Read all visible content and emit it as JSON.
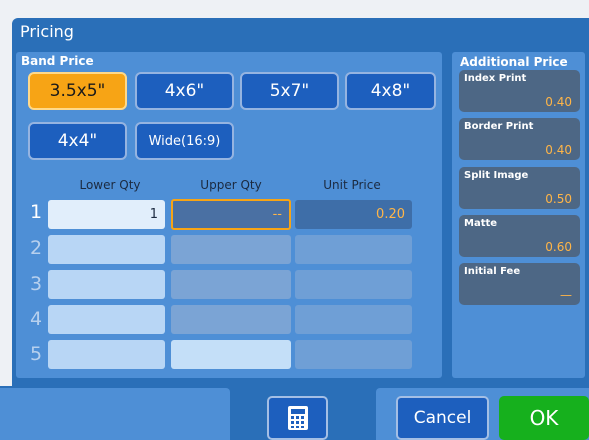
{
  "window": {
    "title": "Pricing"
  },
  "band_price": {
    "label": "Band Price",
    "sizes": [
      "3.5x5\"",
      "4x6\"",
      "5x7\"",
      "4x8\"",
      "4x4\"",
      "Wide(16:9)"
    ],
    "selected": "3.5x5\""
  },
  "table": {
    "headers": [
      "Lower Qty",
      "Upper Qty",
      "Unit Price"
    ],
    "rows": [
      {
        "num": "1",
        "lower": "1",
        "upper": "--",
        "unit": "0.20"
      },
      {
        "num": "2",
        "lower": "",
        "upper": "",
        "unit": ""
      },
      {
        "num": "3",
        "lower": "",
        "upper": "",
        "unit": ""
      },
      {
        "num": "4",
        "lower": "",
        "upper": "",
        "unit": ""
      },
      {
        "num": "5",
        "lower": "",
        "upper": "",
        "unit": ""
      }
    ]
  },
  "additional_price": {
    "label": "Additional Price",
    "items": [
      {
        "label": "Index Print",
        "value": "0.40"
      },
      {
        "label": "Border Print",
        "value": "0.40"
      },
      {
        "label": "Split Image",
        "value": "0.50"
      },
      {
        "label": "Matte",
        "value": "0.60"
      },
      {
        "label": "Initial Fee",
        "value": "—"
      }
    ]
  },
  "buttons": {
    "cancel": "Cancel",
    "ok": "OK",
    "calculator_icon": "calculator-icon"
  },
  "colors": {
    "accent": "#f7a415",
    "ok_green": "#16b01d",
    "panel_blue": "#4e8fd6"
  }
}
